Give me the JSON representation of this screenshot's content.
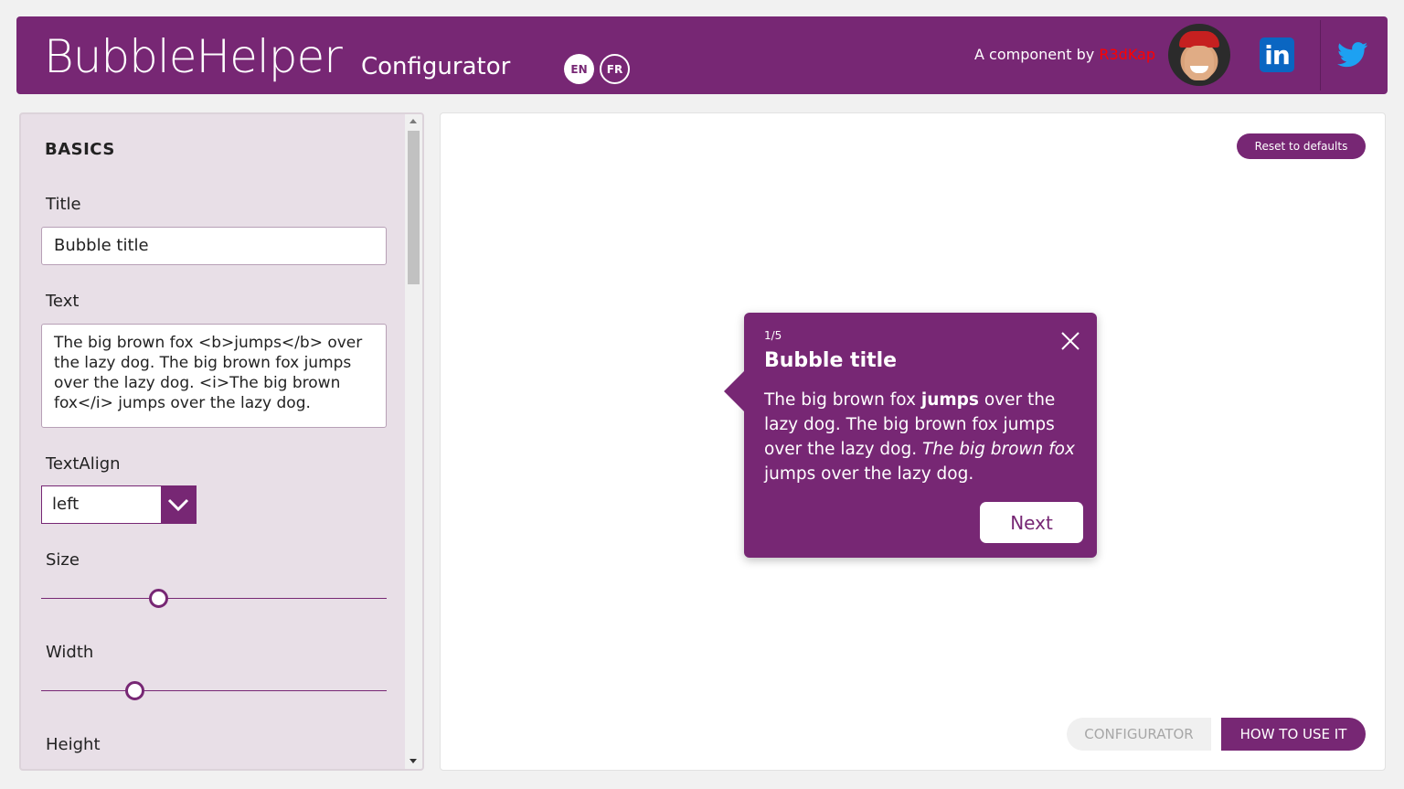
{
  "header": {
    "app_title": "BubbleHelper",
    "app_subtitle": "Configurator",
    "languages": [
      "EN",
      "FR"
    ],
    "credit_prefix": "A component by",
    "credit_author": "R3dKap",
    "linkedin_label": "in",
    "colors": {
      "brand": "#772774",
      "author": "#ff0000"
    }
  },
  "left_panel": {
    "section_title": "BASICS",
    "title_label": "Title",
    "title_value": "Bubble title",
    "text_label": "Text",
    "text_value": "The big brown fox <b>jumps</b> over the lazy dog. The big brown fox jumps over the lazy dog. <i>The big brown fox</i> jumps over the lazy dog.",
    "textalign_label": "TextAlign",
    "textalign_value": "left",
    "size_label": "Size",
    "size_value": 0.34,
    "width_label": "Width",
    "width_value": 0.27,
    "height_label": "Height"
  },
  "preview": {
    "reset_label": "Reset to defaults",
    "bubble": {
      "step": "1/5",
      "title": "Bubble title",
      "text_1": "The big brown fox ",
      "text_bold": "jumps",
      "text_2": " over the lazy dog. The big brown fox jumps over the lazy dog. ",
      "text_italic": "The big brown fox",
      "text_3": " jumps over the lazy dog.",
      "next_label": "Next"
    },
    "tabs": {
      "configurator": "CONFIGURATOR",
      "how_to": "HOW TO USE IT"
    }
  }
}
